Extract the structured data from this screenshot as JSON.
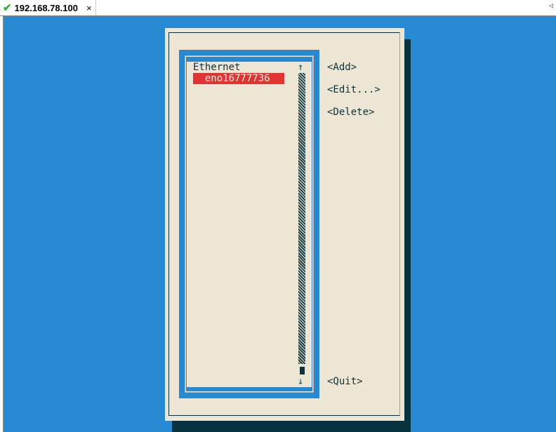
{
  "tab": {
    "title": "192.168.78.100",
    "status_icon": "check-icon",
    "close": "×"
  },
  "list": {
    "header": "Ethernet",
    "items": [
      "  eno16777736"
    ],
    "selected_index": 0,
    "scroll_position": 1.0
  },
  "buttons": {
    "add": "<Add>",
    "edit": "<Edit...>",
    "delete": "<Delete>",
    "quit": "<Quit>"
  },
  "colors": {
    "background": "#2889d3",
    "dialog": "#ede6d5",
    "selection": "#e03333",
    "text": "#0a3340"
  }
}
